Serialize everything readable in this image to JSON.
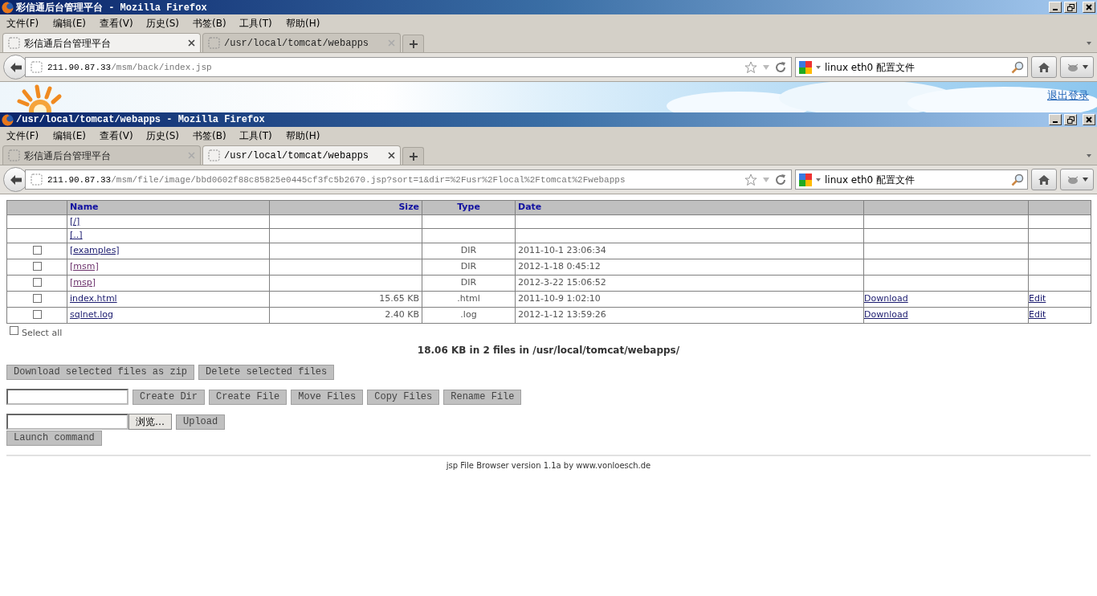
{
  "windows": [
    {
      "title": "彩信通后台管理平台 - Mozilla Firefox",
      "menu": [
        "文件(F)",
        "编辑(E)",
        "查看(V)",
        "历史(S)",
        "书签(B)",
        "工具(T)",
        "帮助(H)"
      ],
      "tabs": [
        {
          "label": "彩信通后台管理平台",
          "selected": true
        },
        {
          "label": "/usr/local/tomcat/webapps",
          "selected": false
        }
      ],
      "url": {
        "host": "211.90.87.33",
        "path": "/msm/back/index.jsp"
      },
      "search": "linux eth0 配置文件",
      "page": {
        "kind": "banner",
        "logout": "退出登录"
      }
    },
    {
      "title": "/usr/local/tomcat/webapps - Mozilla Firefox",
      "menu": [
        "文件(F)",
        "编辑(E)",
        "查看(V)",
        "历史(S)",
        "书签(B)",
        "工具(T)",
        "帮助(H)"
      ],
      "tabs": [
        {
          "label": "彩信通后台管理平台",
          "selected": false
        },
        {
          "label": "/usr/local/tomcat/webapps",
          "selected": true
        }
      ],
      "url": {
        "host": "211.90.87.33",
        "path": "/msm/file/image/bbd0602f88c85825e0445cf3fc5b2670.jsp?sort=1&dir=%2Fusr%2Flocal%2Ftomcat%2Fwebapps"
      },
      "search": "linux eth0 配置文件",
      "page": {
        "kind": "file-browser",
        "columns": [
          "Name",
          "Size",
          "Type",
          "Date"
        ],
        "rows": [
          {
            "kind": "nav",
            "name": "[/]"
          },
          {
            "kind": "nav",
            "name": "[..]"
          },
          {
            "kind": "entry",
            "checked": false,
            "visited": false,
            "name": "[examples]",
            "type": "DIR",
            "date": "2011-10-1 23:06:34"
          },
          {
            "kind": "entry",
            "checked": false,
            "visited": true,
            "name": "[msm]",
            "type": "DIR",
            "date": "2012-1-18 0:45:12"
          },
          {
            "kind": "entry",
            "checked": false,
            "visited": true,
            "name": "[msp]",
            "type": "DIR",
            "date": "2012-3-22 15:06:52"
          },
          {
            "kind": "entry",
            "checked": false,
            "visited": false,
            "name": "index.html",
            "size": "15.65 KB",
            "type": ".html",
            "date": "2011-10-9 1:02:10",
            "download": "Download",
            "edit": "Edit"
          },
          {
            "kind": "entry",
            "checked": false,
            "visited": false,
            "name": "sqlnet.log",
            "size": "2.40 KB",
            "type": ".log",
            "date": "2012-1-12 13:59:26",
            "download": "Download",
            "edit": "Edit"
          }
        ],
        "select_all": {
          "label": "Select all",
          "checked": false
        },
        "summary": {
          "text": "18.06 KB in 2 files in ",
          "path": "/usr/local/tomcat/webapps/"
        },
        "actions": [
          {
            "kind": "buttons",
            "buttons": [
              "Download selected files as zip",
              "Delete selected files"
            ]
          },
          {
            "kind": "field",
            "buttons": [
              "Create Dir",
              "Create File",
              "Move Files",
              "Copy Files",
              "Rename File"
            ]
          },
          {
            "kind": "upload",
            "browse": "浏览…",
            "buttons": [
              "Upload"
            ]
          },
          {
            "kind": "buttons",
            "buttons": [
              "Launch command"
            ]
          }
        ],
        "footer": {
          "text": "jsp File Browser version 1.1a by ",
          "link": "www.vonloesch.de"
        }
      }
    }
  ]
}
